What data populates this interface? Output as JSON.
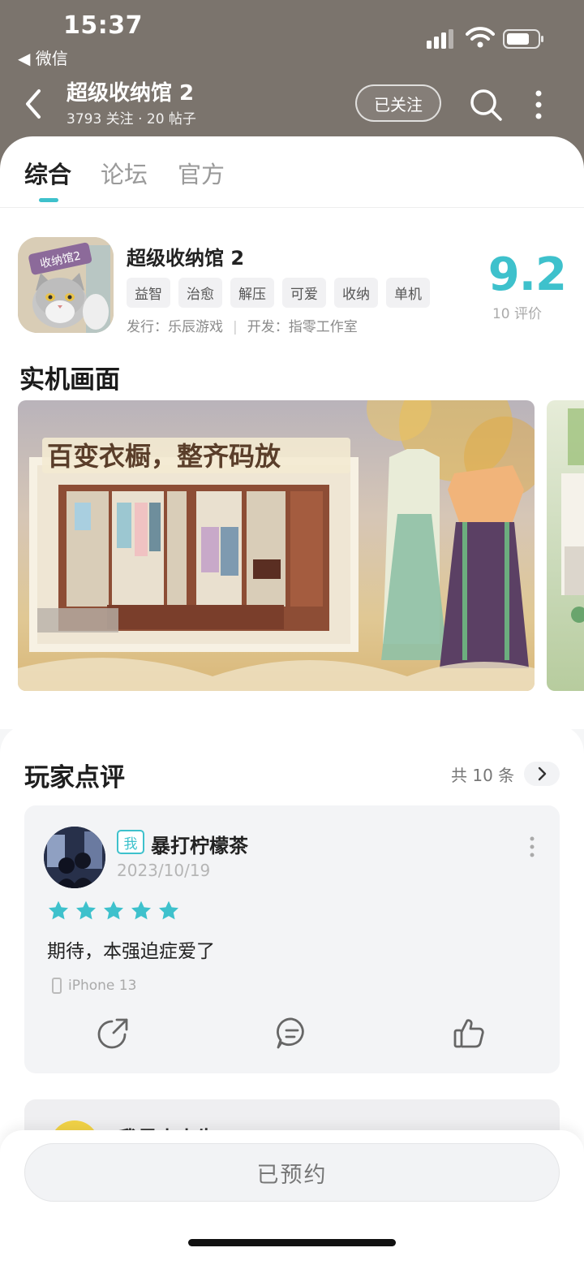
{
  "status_bar": {
    "time": "15:37",
    "back_app": "◀ 微信"
  },
  "header": {
    "title": "超级收纳馆 2",
    "subtitle": "3793 关注 · 20 帖子",
    "follow_label": "已关注"
  },
  "tabs": [
    {
      "label": "综合",
      "active": true
    },
    {
      "label": "论坛",
      "active": false
    },
    {
      "label": "官方",
      "active": false
    }
  ],
  "game": {
    "name": "超级收纳馆 2",
    "icon_text": "收纳馆2",
    "tags": [
      "益智",
      "治愈",
      "解压",
      "可爱",
      "收纳",
      "单机"
    ],
    "publisher": "发行：乐辰游戏",
    "developer": "开发：指零工作室",
    "score": "9.2",
    "rating_count": "10 评价"
  },
  "screenshots": {
    "title": "实机画面",
    "banner_text": "百变衣橱，整齐码放"
  },
  "reviews": {
    "title": "玩家点评",
    "count_label": "共 10 条",
    "items": [
      {
        "badge": "我",
        "username": "暴打柠檬茶",
        "date": "2023/10/19",
        "stars": 5,
        "text": "期待，本强迫症爱了",
        "device": "iPhone 13"
      },
      {
        "username": "我是小小牛"
      }
    ]
  },
  "bottom": {
    "reserve_label": "已预约"
  },
  "colors": {
    "accent": "#3ec1cc",
    "header_bg": "#7b746d"
  }
}
